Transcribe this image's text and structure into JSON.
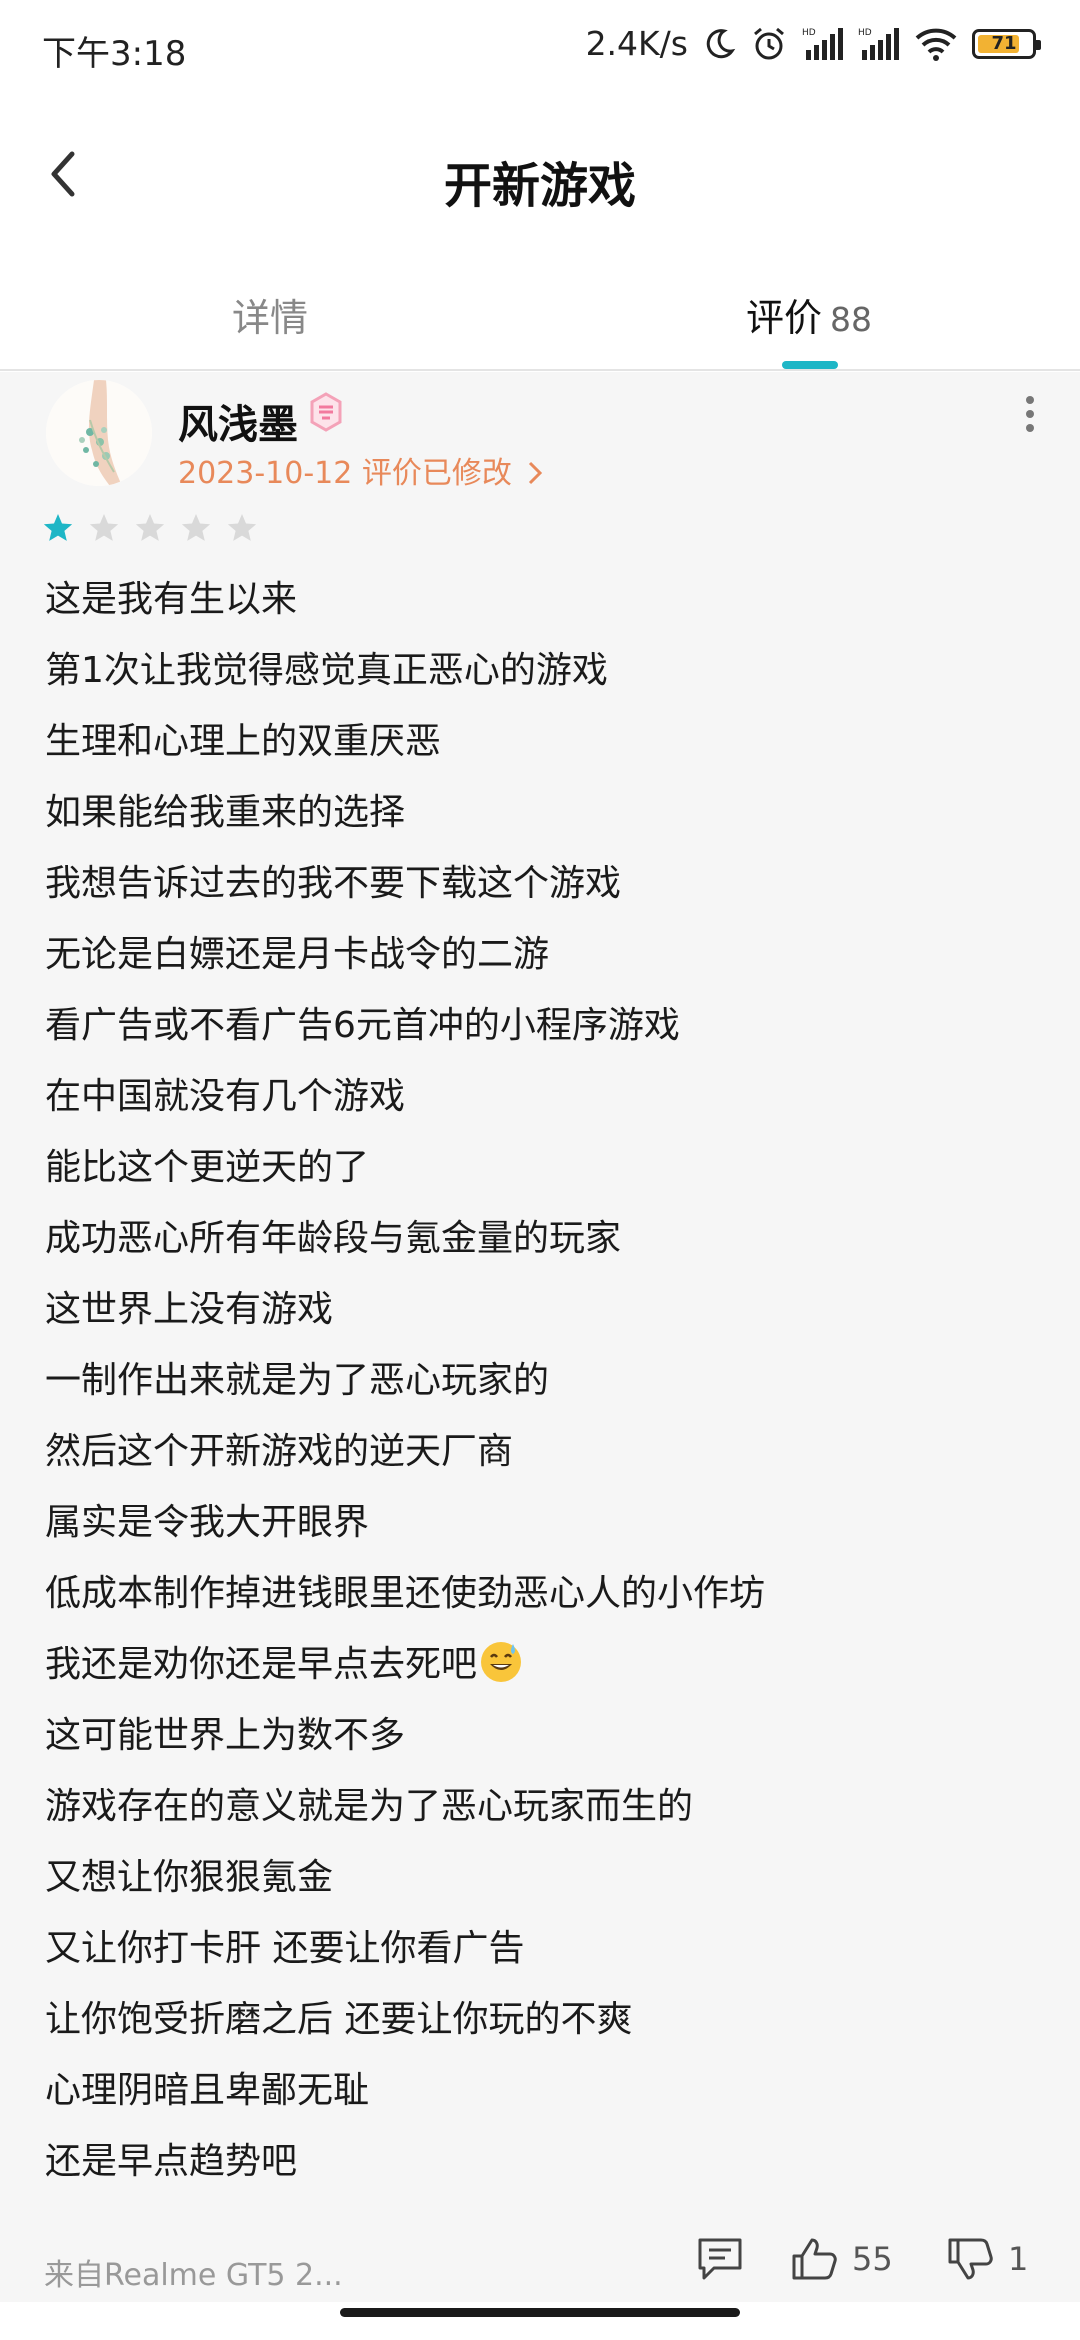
{
  "status_bar": {
    "time": "下午3:18",
    "network_speed": "2.4K/s",
    "battery_level": "71",
    "icons": [
      "moon-icon",
      "alarm-icon",
      "signal-hd-icon",
      "signal-hd-icon",
      "wifi-icon",
      "battery-icon"
    ]
  },
  "header": {
    "back_icon": "chevron-left-icon",
    "title": "开新游戏"
  },
  "tabs": [
    {
      "label": "详情",
      "active": false
    },
    {
      "label": "评价",
      "count": "88",
      "active": true
    }
  ],
  "review": {
    "username": "风浅墨",
    "date_meta": "2023-10-12 评价已修改",
    "rating": 1,
    "rating_max": 5,
    "lines": [
      "这是我有生以来",
      "第1次让我觉得感觉真正恶心的游戏",
      "生理和心理上的双重厌恶",
      "如果能给我重来的选择",
      "我想告诉过去的我不要下载这个游戏",
      "无论是白嫖还是月卡战令的二游",
      "看广告或不看广告6元首冲的小程序游戏",
      "在中国就没有几个游戏",
      "能比这个更逆天的了",
      "成功恶心所有年龄段与氪金量的玩家",
      "这世界上没有游戏",
      "一制作出来就是为了恶心玩家的",
      "然后这个开新游戏的逆天厂商",
      "属实是令我大开眼界",
      "低成本制作掉进钱眼里还使劲恶心人的小作坊",
      "我还是劝你还是早点去死吧",
      "这可能世界上为数不多",
      "游戏存在的意义就是为了恶心玩家而生的",
      "又想让你狠狠氪金",
      "又让你打卡肝 还要让你看广告",
      "让你饱受折磨之后 还要让你玩的不爽",
      "心理阴暗且卑鄙无耻",
      "还是早点趋势吧"
    ],
    "device": "来自Realme GT5 2...",
    "likes": "55",
    "dislikes": "1"
  },
  "colors": {
    "accent": "#1eb6c6",
    "meta": "#e8895a",
    "star_active": "#1eb6c6",
    "star_inactive": "#d9d9d9"
  }
}
